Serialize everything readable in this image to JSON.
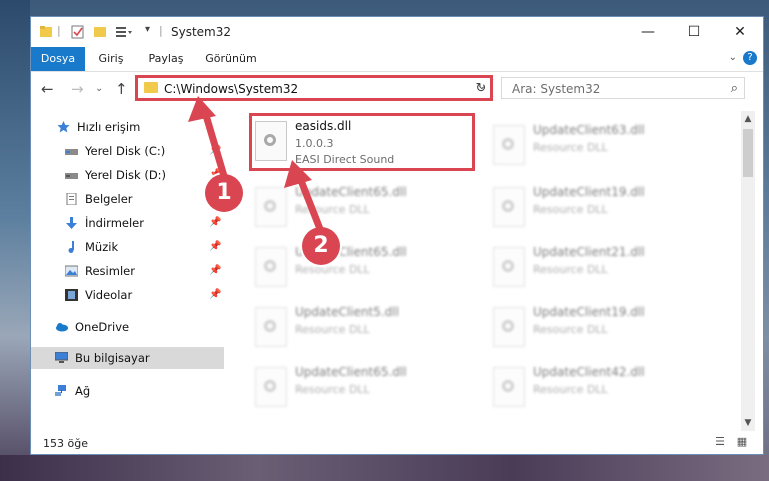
{
  "window": {
    "title": "System32",
    "controls": {
      "minimize": "—",
      "maximize": "☐",
      "close": "✕"
    }
  },
  "ribbon": {
    "tabs": [
      {
        "label": "Dosya",
        "active": true
      },
      {
        "label": "Giriş",
        "active": false
      },
      {
        "label": "Paylaş",
        "active": false
      },
      {
        "label": "Görünüm",
        "active": false
      }
    ],
    "help": "?"
  },
  "navbar": {
    "address": "C:\\Windows\\System32",
    "search_placeholder": "Ara: System32"
  },
  "sidebar": {
    "items": [
      {
        "label": "Hızlı erişim",
        "icon": "star-icon",
        "pinned": false,
        "indent": 1
      },
      {
        "label": "Yerel Disk (C:)",
        "icon": "drive-icon",
        "pinned": true,
        "indent": 2
      },
      {
        "label": "Yerel Disk (D:)",
        "icon": "drive-icon",
        "pinned": true,
        "indent": 2
      },
      {
        "label": "Belgeler",
        "icon": "documents-icon",
        "pinned": true,
        "indent": 2
      },
      {
        "label": "İndirmeler",
        "icon": "download-icon",
        "pinned": true,
        "indent": 2
      },
      {
        "label": "Müzik",
        "icon": "music-icon",
        "pinned": true,
        "indent": 2
      },
      {
        "label": "Resimler",
        "icon": "pictures-icon",
        "pinned": true,
        "indent": 2
      },
      {
        "label": "Videolar",
        "icon": "videos-icon",
        "pinned": true,
        "indent": 2
      },
      {
        "label": "OneDrive",
        "icon": "cloud-icon",
        "pinned": false,
        "indent": 1
      },
      {
        "label": "Bu bilgisayar",
        "icon": "computer-icon",
        "pinned": false,
        "indent": 1,
        "selected": true
      },
      {
        "label": "Ağ",
        "icon": "network-icon",
        "pinned": false,
        "indent": 1
      }
    ]
  },
  "files": {
    "highlighted": {
      "name": "easids.dll",
      "version": "1.0.0.3",
      "description": "EASI Direct Sound"
    },
    "left_column": [
      {
        "name": "UpdateClient65.dll",
        "description": "Resource DLL"
      },
      {
        "name": "UpdateClient65.dll",
        "description": "Resource DLL"
      },
      {
        "name": "UpdateClient5.dll",
        "description": "Resource DLL"
      },
      {
        "name": "UpdateClient65.dll",
        "description": "Resource DLL"
      }
    ],
    "right_column": [
      {
        "name": "UpdateClient63.dll",
        "description": "Resource DLL"
      },
      {
        "name": "UpdateClient19.dll",
        "description": "Resource DLL"
      },
      {
        "name": "UpdateClient21.dll",
        "description": "Resource DLL"
      },
      {
        "name": "UpdateClient19.dll",
        "description": "Resource DLL"
      },
      {
        "name": "UpdateClient42.dll",
        "description": "Resource DLL"
      }
    ]
  },
  "status": {
    "count": "153 öğe"
  },
  "annotations": {
    "marker1": "1",
    "marker2": "2",
    "accent": "#d94550"
  }
}
